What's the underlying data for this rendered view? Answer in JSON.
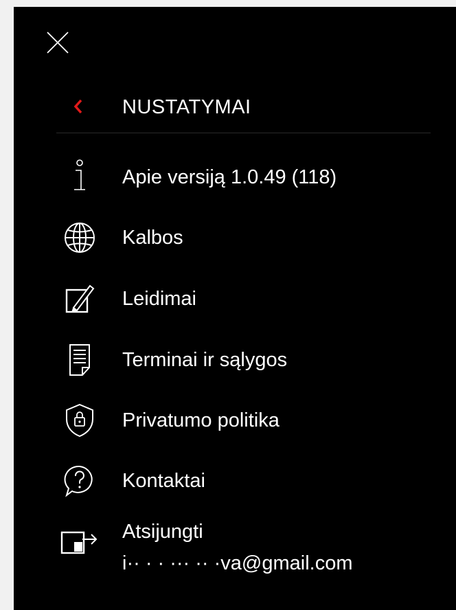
{
  "close_icon": "close-icon",
  "back_icon": "chevron-left-icon",
  "header": {
    "title": "NUSTATYMAI"
  },
  "colors": {
    "background": "#000000",
    "text": "#ffffff",
    "accent": "#e01a1a",
    "outer": "#f1f1f1"
  },
  "menu": {
    "items": [
      {
        "label": "Apie versiją 1.0.49 (118)",
        "icon": "info-icon"
      },
      {
        "label": "Kalbos",
        "icon": "globe-icon"
      },
      {
        "label": "Leidimai",
        "icon": "edit-permissions-icon"
      },
      {
        "label": "Terminai ir sąlygos",
        "icon": "document-icon"
      },
      {
        "label": "Privatumo politika",
        "icon": "shield-lock-icon"
      },
      {
        "label": "Kontaktai",
        "icon": "help-bubble-icon"
      },
      {
        "label": "Atsijungti",
        "sublabel": "i·· · · ··· ·· ·va@gmail.com",
        "icon": "logout-icon"
      }
    ]
  }
}
